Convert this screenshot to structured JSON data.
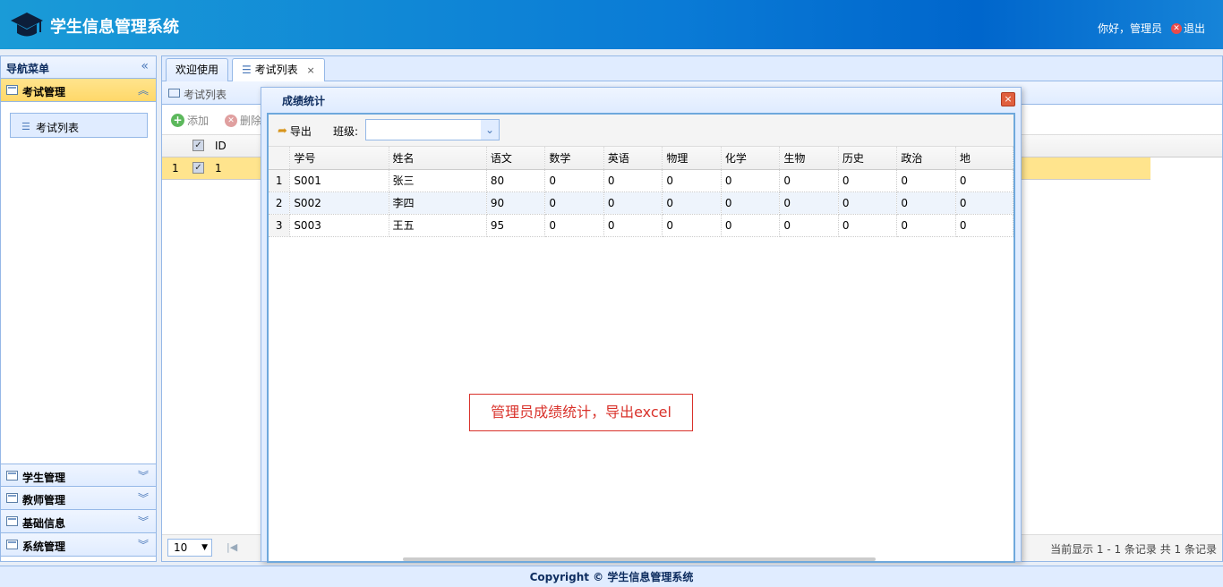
{
  "header": {
    "title": "学生信息管理系统",
    "greeting": "你好，管理员",
    "logout": "退出",
    "logo_icon": "graduation-cap-icon"
  },
  "sidebar": {
    "title": "导航菜单",
    "sections": [
      {
        "label": "考试管理",
        "active": true,
        "items": [
          {
            "label": "考试列表"
          }
        ]
      },
      {
        "label": "学生管理"
      },
      {
        "label": "教师管理"
      },
      {
        "label": "基础信息"
      },
      {
        "label": "系统管理"
      }
    ]
  },
  "tabs": [
    {
      "label": "欢迎使用"
    },
    {
      "label": "考试列表",
      "active": true,
      "close": "×"
    }
  ],
  "panel": {
    "title": "考试列表",
    "toolbar": {
      "add": "添加",
      "delete": "删除"
    },
    "grid": {
      "columns": [
        "ID"
      ],
      "rows": [
        {
          "num": "1",
          "id": "1"
        }
      ]
    },
    "pager": {
      "page_size": "10",
      "info": "当前显示 1 - 1 条记录 共 1 条记录"
    }
  },
  "dialog": {
    "title": "成绩统计",
    "close": "×",
    "export": "导出",
    "class_label": "班级:",
    "class_value": "",
    "columns": [
      "学号",
      "姓名",
      "语文",
      "数学",
      "英语",
      "物理",
      "化学",
      "生物",
      "历史",
      "政治",
      "地"
    ],
    "rows": [
      {
        "num": "1",
        "cells": [
          "S001",
          "张三",
          "80",
          "0",
          "0",
          "0",
          "0",
          "0",
          "0",
          "0",
          "0"
        ]
      },
      {
        "num": "2",
        "cells": [
          "S002",
          "李四",
          "90",
          "0",
          "0",
          "0",
          "0",
          "0",
          "0",
          "0",
          "0"
        ]
      },
      {
        "num": "3",
        "cells": [
          "S003",
          "王五",
          "95",
          "0",
          "0",
          "0",
          "0",
          "0",
          "0",
          "0",
          "0"
        ]
      }
    ]
  },
  "annotation": "管理员成绩统计，导出excel",
  "footer": "Copyright © 学生信息管理系统",
  "colors": {
    "header_start": "#1a9bd7",
    "header_end": "#0066cc",
    "active_section": "#ffd869",
    "border": "#95b8e7",
    "annotation": "#d9322b"
  }
}
